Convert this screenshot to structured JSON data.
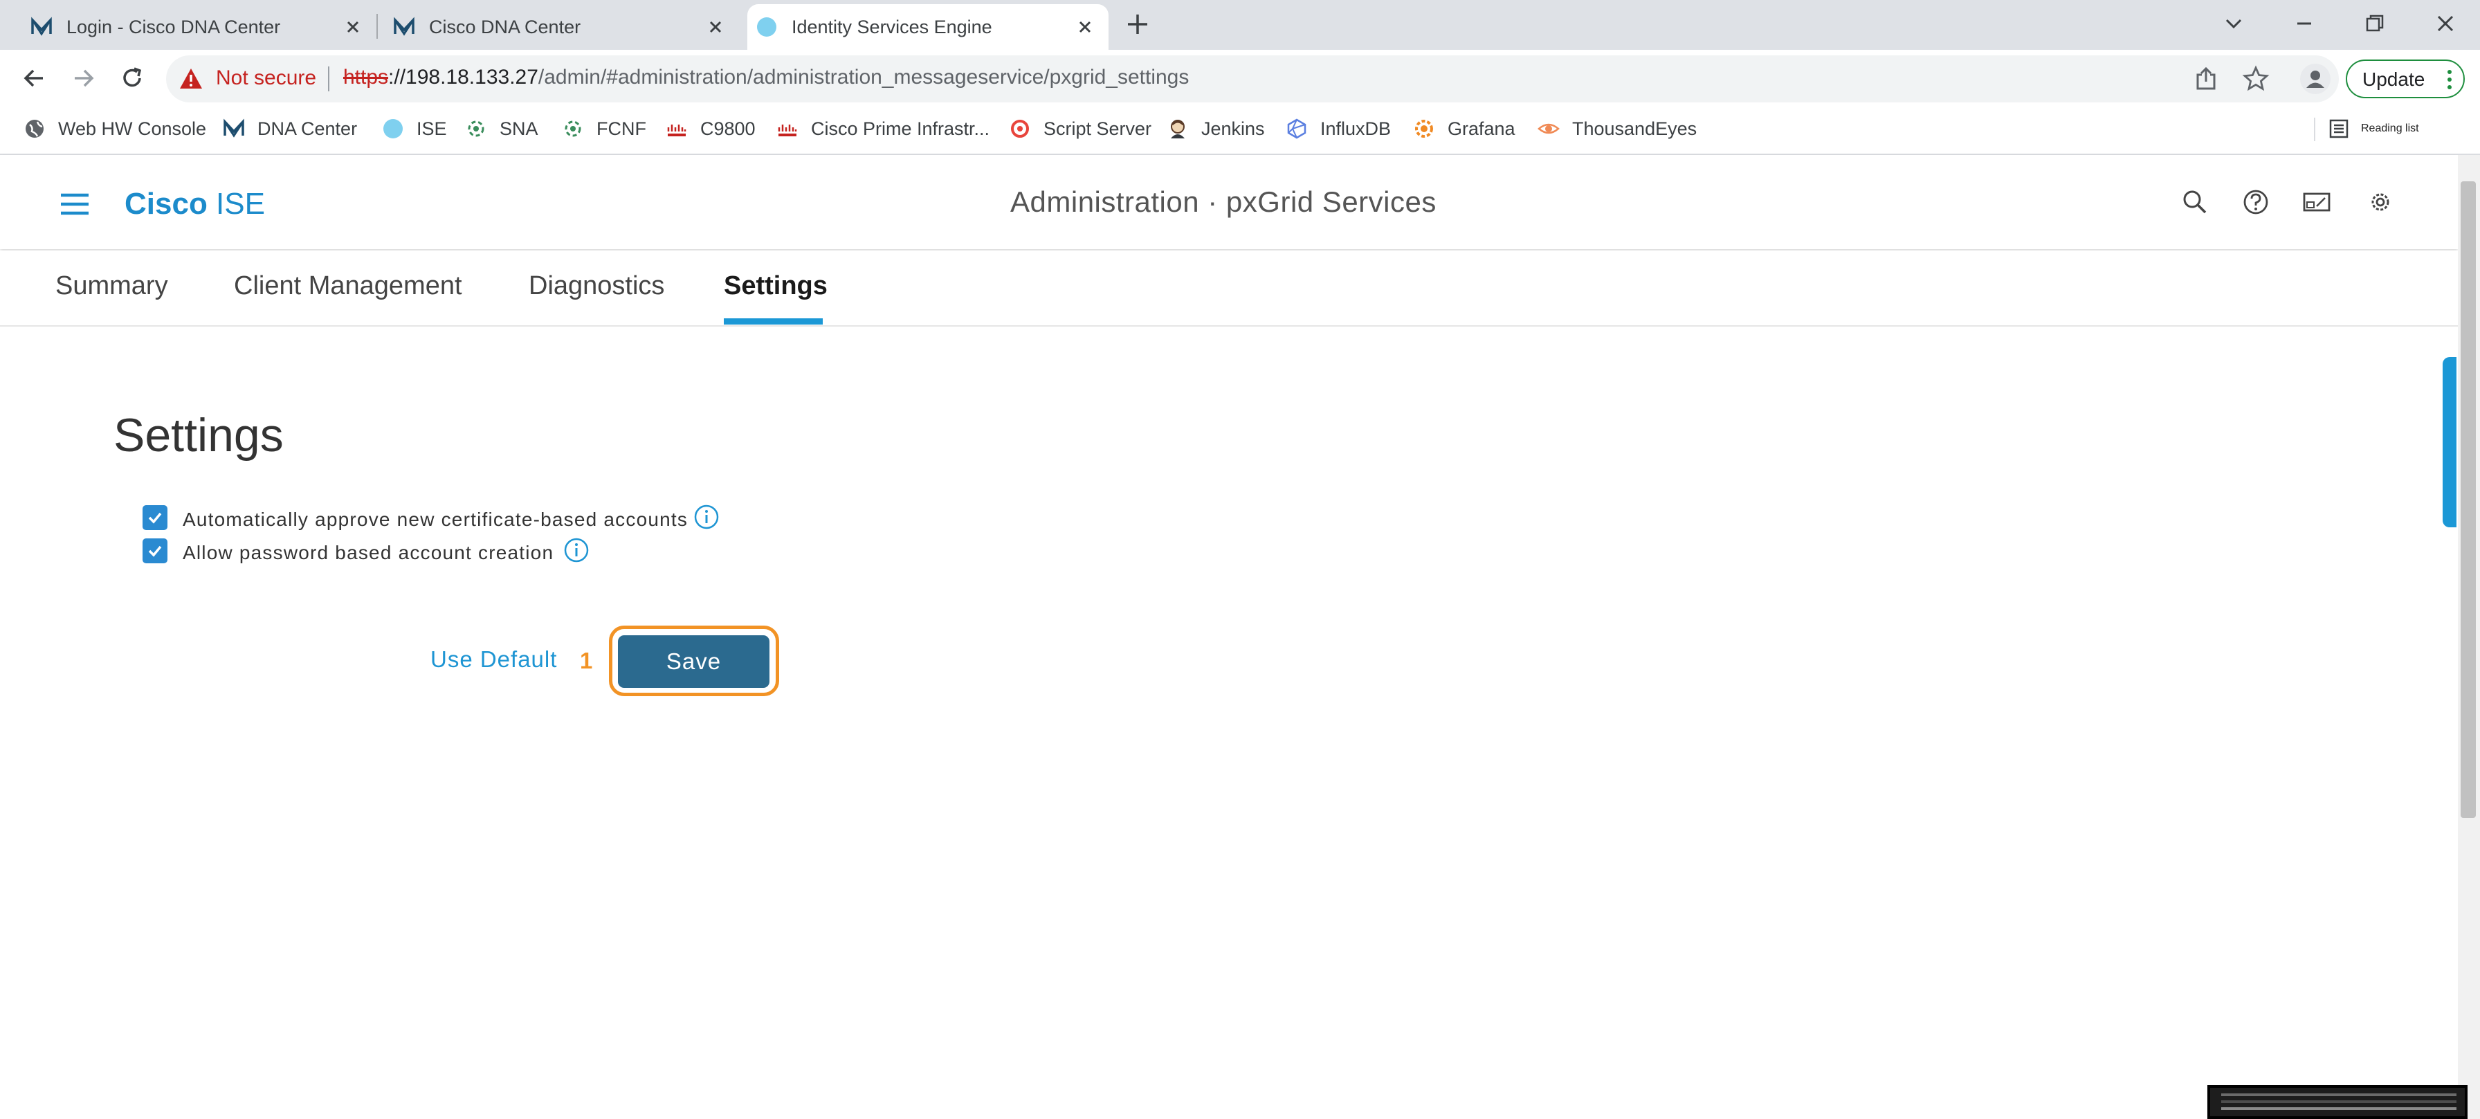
{
  "browser": {
    "tabs": [
      {
        "title": "Login - Cisco DNA Center",
        "icon": "dna-center-icon",
        "active": false
      },
      {
        "title": "Cisco DNA Center",
        "icon": "dna-center-icon",
        "active": false
      },
      {
        "title": "Identity Services Engine",
        "icon": "ise-globe-icon",
        "active": true
      }
    ],
    "address": {
      "security_label": "Not secure",
      "protocol": "https",
      "host": "://198.18.133.27",
      "path": "/admin/#administration/administration_messageservice/pxgrid_settings"
    },
    "update_label": "Update",
    "bookmarks": [
      {
        "label": "Web HW Console",
        "icon": "globe-icon"
      },
      {
        "label": "DNA Center",
        "icon": "dna-center-icon"
      },
      {
        "label": "ISE",
        "icon": "ise-globe-icon"
      },
      {
        "label": "SNA",
        "icon": "sna-icon"
      },
      {
        "label": "FCNF",
        "icon": "fcnf-icon"
      },
      {
        "label": "C9800",
        "icon": "cisco-icon"
      },
      {
        "label": "Cisco Prime Infrastr...",
        "icon": "cisco-icon"
      },
      {
        "label": "Script Server",
        "icon": "script-server-icon"
      },
      {
        "label": "Jenkins",
        "icon": "jenkins-icon"
      },
      {
        "label": "InfluxDB",
        "icon": "influxdb-icon"
      },
      {
        "label": "Grafana",
        "icon": "grafana-icon"
      },
      {
        "label": "ThousandEyes",
        "icon": "thousandeyes-icon"
      }
    ],
    "reading_list_label": "Reading list"
  },
  "app": {
    "brand_bold": "Cisco",
    "brand_light": " ISE",
    "page_title": "Administration · pxGrid Services",
    "accent_color": "#1b98d6"
  },
  "subnav": {
    "tabs": [
      "Summary",
      "Client Management",
      "Diagnostics",
      "Settings"
    ],
    "active_tab": "Settings"
  },
  "settings": {
    "heading": "Settings",
    "options": [
      {
        "label": "Automatically approve new certificate-based accounts",
        "checked": true
      },
      {
        "label": "Allow password based account creation",
        "checked": true
      }
    ],
    "use_default_label": "Use Default",
    "step_number": "1",
    "save_label": "Save"
  }
}
